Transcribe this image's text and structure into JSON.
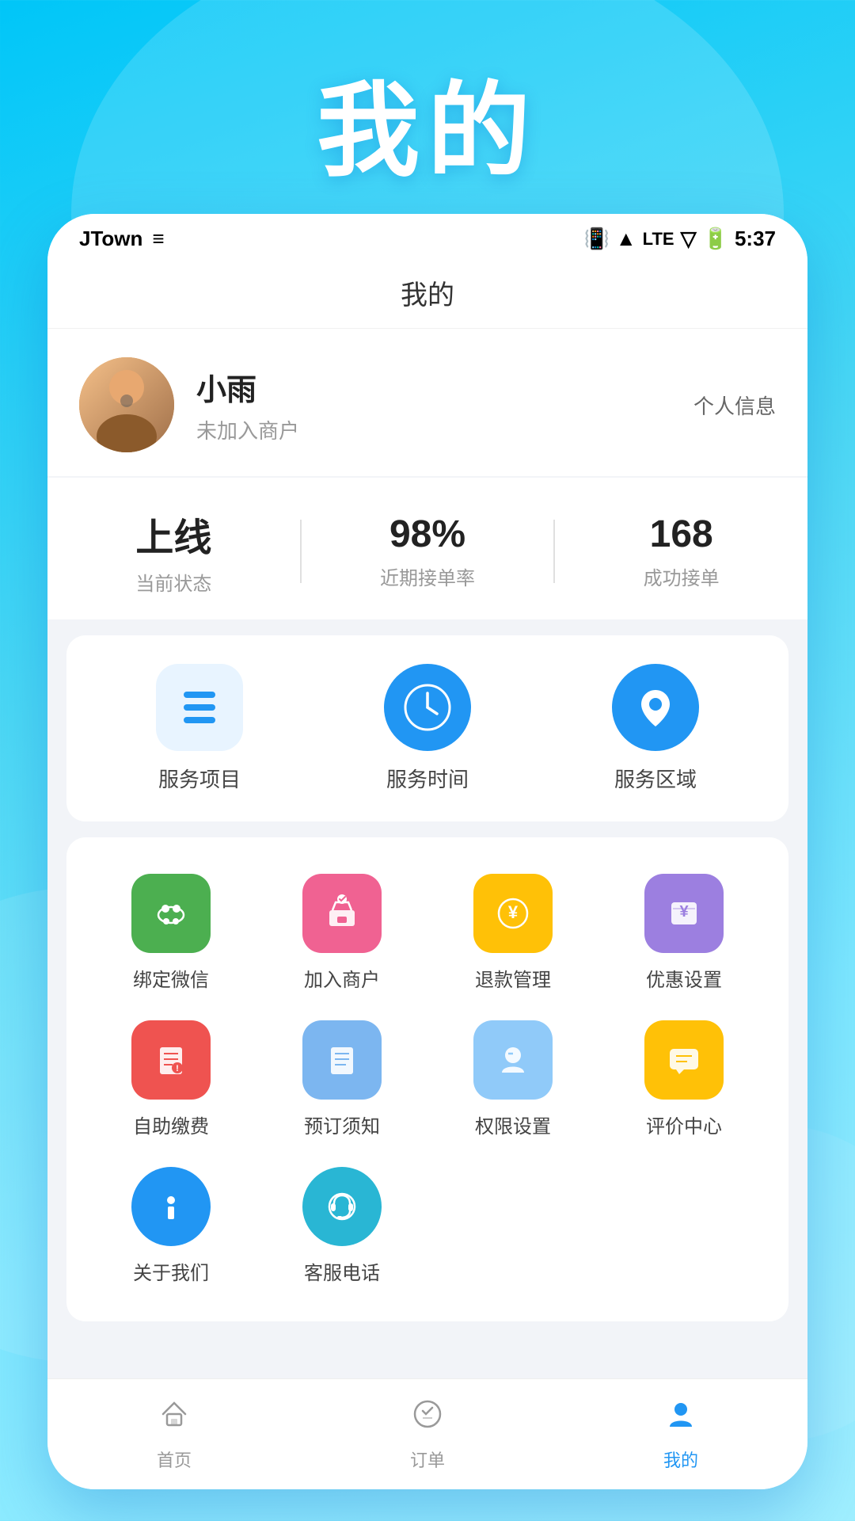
{
  "background": {
    "title": "我的"
  },
  "statusBar": {
    "appName": "JTown",
    "time": "5:37"
  },
  "header": {
    "title": "我的"
  },
  "profile": {
    "name": "小雨",
    "subtitle": "未加入商户",
    "link": "个人信息",
    "avatarAlt": "user avatar"
  },
  "stats": [
    {
      "id": "status",
      "value": "上线",
      "label": "当前状态"
    },
    {
      "id": "acceptance",
      "value": "98%",
      "label": "近期接单率"
    },
    {
      "id": "orders",
      "value": "168",
      "label": "成功接单"
    }
  ],
  "serviceItems": [
    {
      "id": "service-project",
      "label": "服务项目",
      "icon": "list"
    },
    {
      "id": "service-time",
      "label": "服务时间",
      "icon": "clock"
    },
    {
      "id": "service-area",
      "label": "服务区域",
      "icon": "location"
    }
  ],
  "menuItems": [
    {
      "id": "bind-wechat",
      "label": "绑定微信",
      "color": "green",
      "icon": "chat"
    },
    {
      "id": "join-merchant",
      "label": "加入商户",
      "color": "red",
      "icon": "shop"
    },
    {
      "id": "refund",
      "label": "退款管理",
      "color": "orange",
      "icon": "yen"
    },
    {
      "id": "discount",
      "label": "优惠设置",
      "color": "purple",
      "icon": "coupon"
    },
    {
      "id": "self-pay",
      "label": "自助缴费",
      "color": "red2",
      "icon": "bill"
    },
    {
      "id": "booking-notice",
      "label": "预订须知",
      "color": "blue-light",
      "icon": "doc"
    },
    {
      "id": "permission",
      "label": "权限设置",
      "color": "blue-light2",
      "icon": "user-minus"
    },
    {
      "id": "review",
      "label": "评价中心",
      "color": "amber",
      "icon": "comment"
    },
    {
      "id": "about-us",
      "label": "关于我们",
      "color": "blue",
      "icon": "info"
    },
    {
      "id": "customer-service",
      "label": "客服电话",
      "color": "blue2",
      "icon": "headset"
    }
  ],
  "bottomNav": [
    {
      "id": "home",
      "label": "首页",
      "active": false
    },
    {
      "id": "orders",
      "label": "订单",
      "active": false
    },
    {
      "id": "mine",
      "label": "我的",
      "active": true
    }
  ]
}
